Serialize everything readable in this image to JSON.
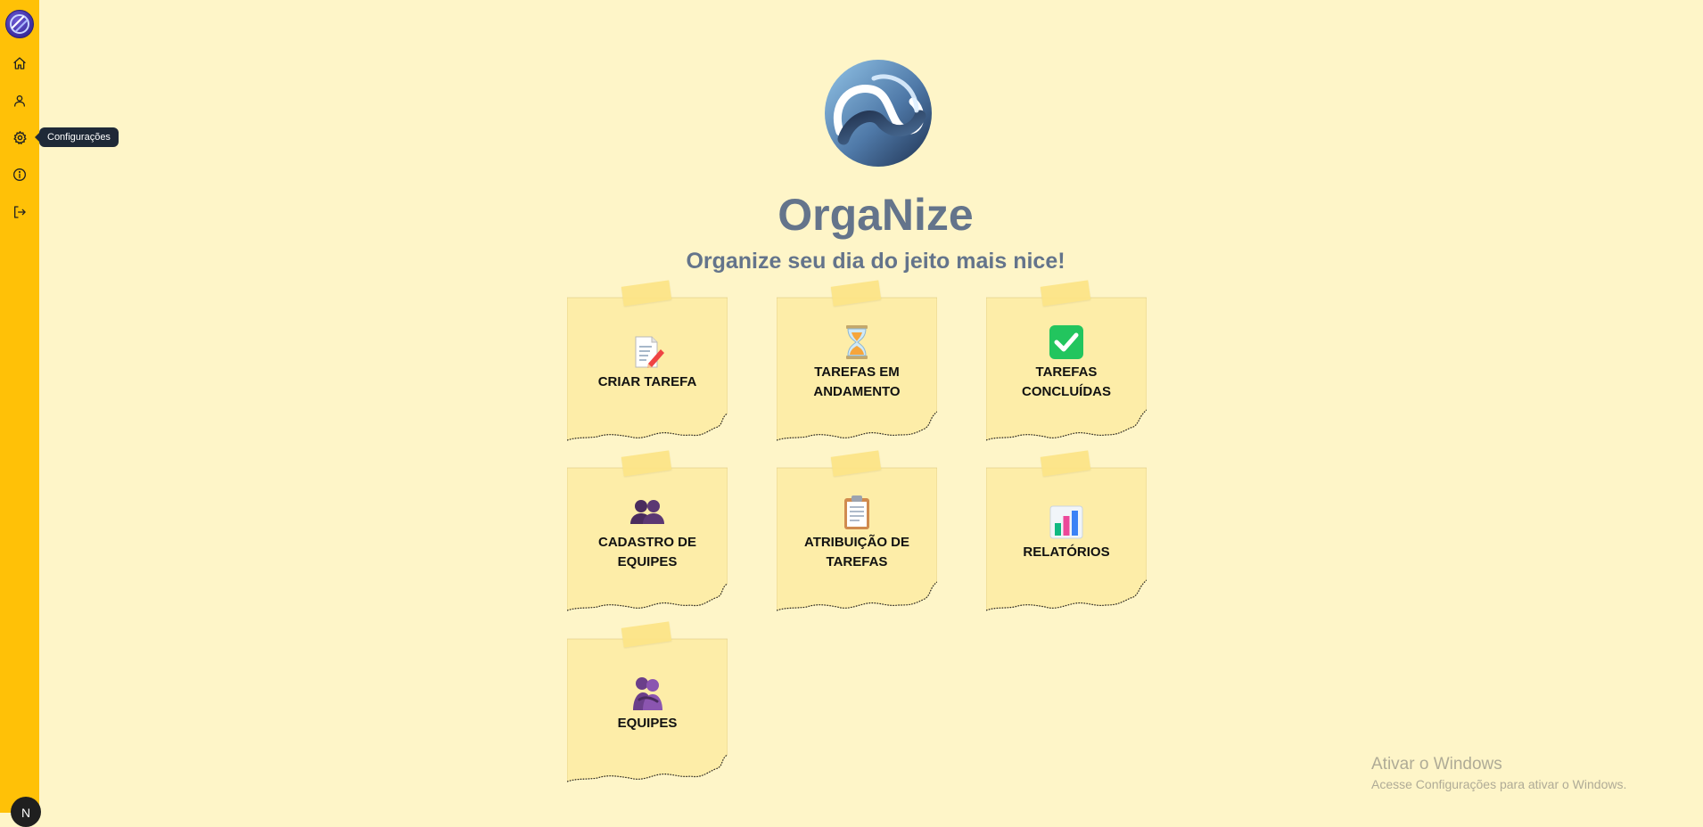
{
  "app": {
    "title": "OrgaNize",
    "tagline": "Organize seu dia do jeito mais nice!"
  },
  "sidebar": {
    "items": [
      {
        "name": "home",
        "icon": "home-icon"
      },
      {
        "name": "profile",
        "icon": "user-icon"
      },
      {
        "name": "settings",
        "icon": "gear-icon",
        "tooltip": "Configurações"
      },
      {
        "name": "about",
        "icon": "info-icon"
      },
      {
        "name": "logout",
        "icon": "logout-icon"
      }
    ],
    "avatar_initial": "N"
  },
  "cards": [
    {
      "label": "CRIAR TAREFA",
      "icon": "memo-pencil-icon"
    },
    {
      "label": "TAREFAS EM ANDAMENTO",
      "icon": "hourglass-icon"
    },
    {
      "label": "TAREFAS CONCLUÍDAS",
      "icon": "check-mark-icon"
    },
    {
      "label": "CADASTRO DE EQUIPES",
      "icon": "busts-icon"
    },
    {
      "label": "ATRIBUIÇÃO DE TAREFAS",
      "icon": "clipboard-icon"
    },
    {
      "label": "RELATÓRIOS",
      "icon": "bar-chart-icon"
    },
    {
      "label": "EQUIPES",
      "icon": "people-hugging-icon"
    }
  ],
  "watermark": {
    "title": "Ativar o Windows",
    "subtitle": "Acesse Configurações para ativar o Windows."
  },
  "colors": {
    "background": "#fef5c8",
    "sidebar": "#ffc107",
    "note": "#fdeda8",
    "title": "#64748b"
  }
}
